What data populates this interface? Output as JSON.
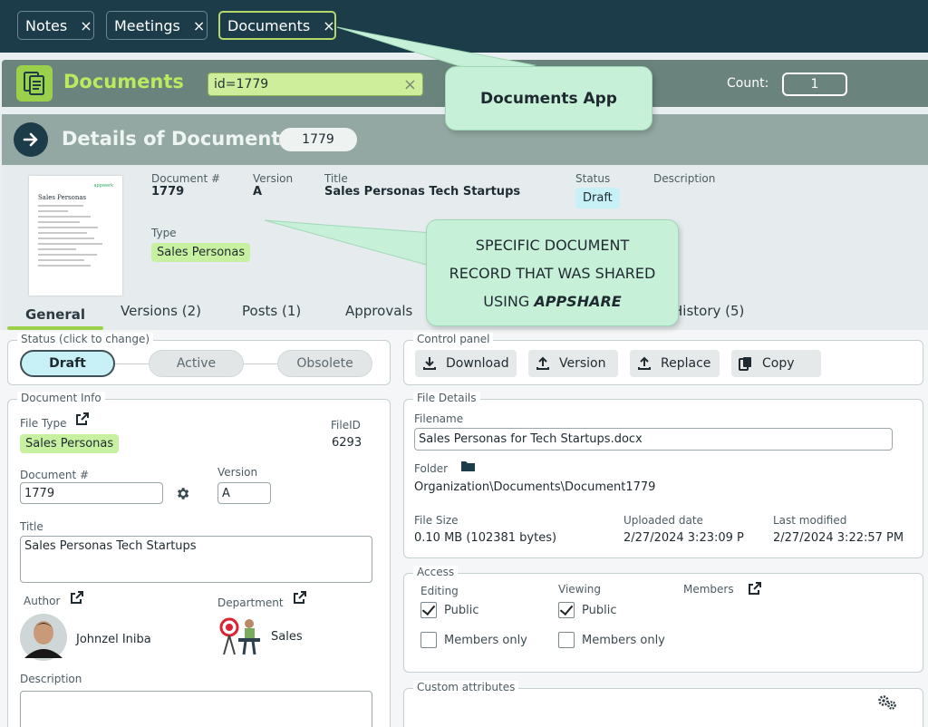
{
  "tabs": [
    {
      "label": "Notes",
      "close": "×"
    },
    {
      "label": "Meetings",
      "close": "×"
    },
    {
      "label": "Documents",
      "close": "×"
    }
  ],
  "app": {
    "title": "Documents",
    "search_value": "id=1779",
    "search_clear": "×",
    "count_label": "Count:",
    "count_value": "1"
  },
  "details": {
    "title": "Details of Document",
    "id_badge": "1779"
  },
  "summary": {
    "thumbnail": {
      "heading": "Sales Personas",
      "brand": "appwerk"
    },
    "doc_no_label": "Document #",
    "doc_no": "1779",
    "version_label": "Version",
    "version": "A",
    "title_label": "Title",
    "title": "Sales Personas Tech Startups",
    "status_label": "Status",
    "status": "Draft",
    "description_label": "Description",
    "type_label": "Type",
    "type": "Sales Personas"
  },
  "callouts": {
    "app": "Documents App",
    "record_lines": [
      "SPECIFIC DOCUMENT",
      "RECORD THAT WAS SHARED",
      "USING"
    ],
    "record_emph": "APPSHARE"
  },
  "subtabs": [
    "General",
    "Versions (2)",
    "Posts (1)",
    "Approvals",
    "History (5)"
  ],
  "status_panel": {
    "legend": "Status (click to change)",
    "options": [
      "Draft",
      "Active",
      "Obsolete"
    ],
    "selected": "Draft"
  },
  "control_panel": {
    "legend": "Control panel",
    "buttons": [
      "Download",
      "Version",
      "Replace",
      "Copy"
    ]
  },
  "doc_info": {
    "legend": "Document Info",
    "file_type_label": "File Type",
    "file_type": "Sales Personas",
    "fileid_label": "FileID",
    "fileid": "6293",
    "doc_no_label": "Document #",
    "doc_no": "1779",
    "version_label": "Version",
    "version": "A",
    "title_label": "Title",
    "title": "Sales Personas Tech Startups",
    "author_label": "Author",
    "author": "Johnzel Iniba",
    "department_label": "Department",
    "department": "Sales",
    "description_label": "Description",
    "description": ""
  },
  "file_details": {
    "legend": "File Details",
    "filename_label": "Filename",
    "filename": "Sales Personas for Tech Startups.docx",
    "folder_label": "Folder",
    "folder": "Organization\\Documents\\Document1779",
    "size_label": "File Size",
    "size": "0.10 MB (102381 bytes)",
    "uploaded_label": "Uploaded date",
    "uploaded": "2/27/2024 3:23:09 PM",
    "modified_label": "Last modified",
    "modified": "2/27/2024 3:22:57 PM"
  },
  "access": {
    "legend": "Access",
    "editing_label": "Editing",
    "viewing_label": "Viewing",
    "members_label": "Members",
    "public_label": "Public",
    "members_only_label": "Members only",
    "editing_public": true,
    "editing_members_only": false,
    "viewing_public": true,
    "viewing_members_only": false
  },
  "custom_attributes": {
    "legend": "Custom attributes"
  },
  "colors": {
    "navy": "#1d3c4a",
    "lime": "#9bd14a",
    "callout": "#c7f0d9",
    "draft_badge": "#c8f1f7"
  }
}
